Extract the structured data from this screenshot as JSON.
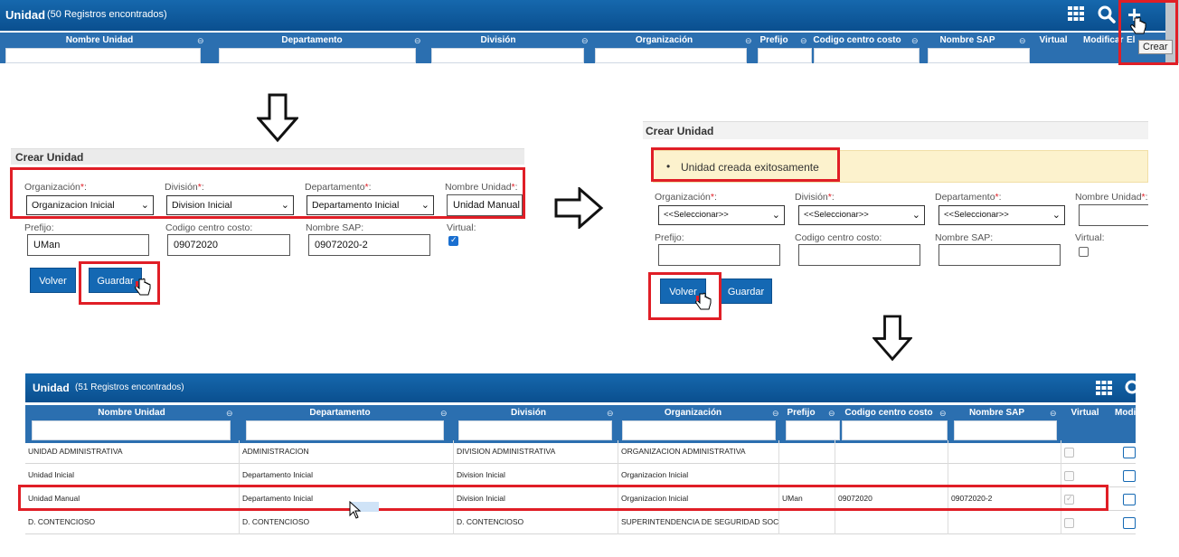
{
  "top_grid": {
    "title": "Unidad",
    "count": "(50 Registros encontrados)",
    "columns": [
      "Nombre Unidad",
      "Departamento",
      "División",
      "Organización",
      "Prefijo",
      "Codigo centro costo",
      "Nombre SAP",
      "Virtual",
      "Modificar",
      "El"
    ],
    "tooltip": "Crear",
    "icons": [
      "grid-icon",
      "search-icon",
      "plus-icon"
    ]
  },
  "form1": {
    "title": "Crear Unidad",
    "labels": {
      "organizacion": "Organización",
      "division": "División",
      "departamento": "Departamento",
      "nombre_unidad": "Nombre Unidad",
      "prefijo": "Prefijo:",
      "codigo": "Codigo centro costo:",
      "nombre_sap": "Nombre SAP:",
      "virtual": "Virtual:",
      "required_mark": "*",
      "colon": ":"
    },
    "values": {
      "organizacion": "Organizacion Inicial",
      "division": "Division Inicial",
      "departamento": "Departamento Inicial",
      "nombre_unidad": "Unidad Manual",
      "prefijo": "UMan",
      "codigo": "09072020",
      "nombre_sap": "09072020-2"
    },
    "virtual_checked": true,
    "buttons": {
      "volver": "Volver",
      "guardar": "Guardar"
    }
  },
  "form2": {
    "title": "Crear Unidad",
    "alert": "Unidad creada exitosamente",
    "labels": {
      "organizacion": "Organización",
      "division": "División",
      "departamento": "Departamento",
      "nombre_unidad": "Nombre Unidad",
      "prefijo": "Prefijo:",
      "codigo": "Codigo centro costo:",
      "nombre_sap": "Nombre SAP:",
      "virtual": "Virtual:",
      "required_mark": "*",
      "colon": ":"
    },
    "values": {
      "organizacion": "<<Seleccionar>>",
      "division": "<<Seleccionar>>",
      "departamento": "<<Seleccionar>>"
    },
    "virtual_checked": false,
    "buttons": {
      "volver": "Volver",
      "guardar": "Guardar"
    }
  },
  "bottom_grid": {
    "title": "Unidad",
    "count": "(51 Registros encontrados)",
    "columns": [
      "Nombre Unidad",
      "Departamento",
      "División",
      "Organización",
      "Prefijo",
      "Codigo centro costo",
      "Nombre SAP",
      "Virtual",
      "Modi"
    ],
    "rows": [
      {
        "nombre": "UNIDAD ADMINISTRATIVA",
        "depto": "ADMINISTRACION",
        "division": "DIVISION ADMINISTRATIVA",
        "org": "ORGANIZACION ADMINISTRATIVA",
        "prefijo": "",
        "codigo": "",
        "sap": "",
        "virtual": false
      },
      {
        "nombre": "Unidad Inicial",
        "depto": "Departamento Inicial",
        "division": "Division Inicial",
        "org": "Organizacion Inicial",
        "prefijo": "",
        "codigo": "",
        "sap": "",
        "virtual": false
      },
      {
        "nombre": "Unidad Manual",
        "depto": "Departamento Inicial",
        "division": "Division Inicial",
        "org": "Organizacion Inicial",
        "prefijo": "UMan",
        "codigo": "09072020",
        "sap": "09072020-2",
        "virtual": true
      },
      {
        "nombre": "D. CONTENCIOSO",
        "depto": "D. CONTENCIOSO",
        "division": "D. CONTENCIOSO",
        "org": "SUPERINTENDENCIA DE SEGURIDAD SOCIAL",
        "prefijo": "",
        "codigo": "",
        "sap": "",
        "virtual": false
      }
    ]
  }
}
